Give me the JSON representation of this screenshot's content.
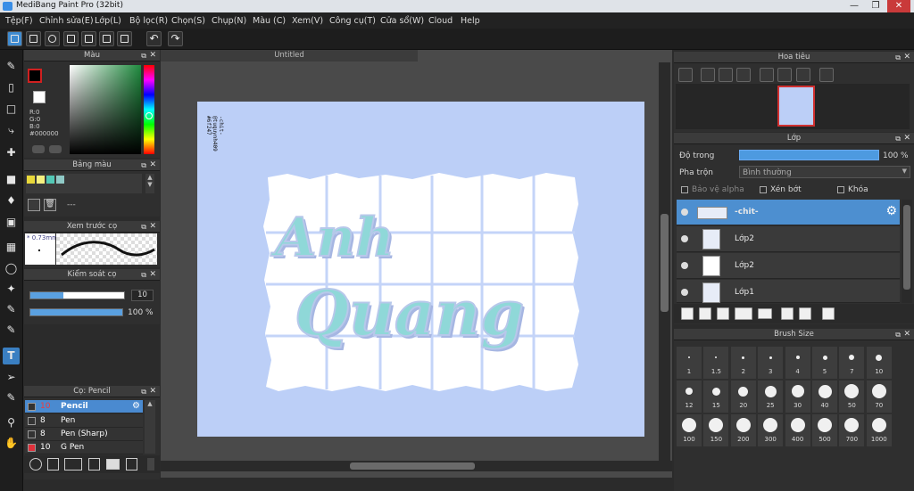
{
  "window": {
    "title": "MediBang Paint Pro (32bit)"
  },
  "menu": [
    "Tệp(F)",
    "Chỉnh sửa(E)",
    "Lớp(L)",
    "Bộ lọc(R)",
    "Chọn(S)",
    "Chụp(N)",
    "Màu (C)",
    "Xem(V)",
    "Công cụ(T)",
    "Cửa sổ(W)",
    "Cloud",
    "Help"
  ],
  "color_panel": {
    "title": "Màu",
    "r": "R:0",
    "g": "G:0",
    "b": "B:0",
    "hex": "#000000",
    "foreground": "#000000"
  },
  "palette_panel": {
    "title": "Bảng màu",
    "swatches": [
      "#e8d83a",
      "#f5f080",
      "#53c8b5",
      "#8fc9c6"
    ],
    "dashes": "---"
  },
  "preview_panel": {
    "title": "Xem trước cọ",
    "size": "0.73mm"
  },
  "control_panel": {
    "title": "Kiểm soát cọ",
    "size_value": "10",
    "opacity_value": "100 %",
    "size_level": 0.35,
    "opacity_level": 1.0
  },
  "brush_panel": {
    "title": "Cọ: Pencil",
    "items": [
      {
        "size": "10",
        "name": "Pencil",
        "color": "#333333",
        "selected": true
      },
      {
        "size": "8",
        "name": "Pen",
        "color": "#333333",
        "selected": false
      },
      {
        "size": "8",
        "name": "Pen (Sharp)",
        "color": "#333333",
        "selected": false
      },
      {
        "size": "10",
        "name": "G Pen",
        "color": "#e0303a",
        "selected": false
      }
    ]
  },
  "canvas": {
    "tab": "Untitled",
    "signature": "-chit-\n@tuquynh409\n#6f247",
    "lettering_line1": "Anh",
    "lettering_line2": "Quang",
    "background": "#bccff7"
  },
  "navigator": {
    "title": "Hoa tiêu"
  },
  "layer_panel": {
    "title": "Lớp",
    "opacity_label": "Độ trong",
    "opacity_value": "100 %",
    "blend_label": "Pha trộn",
    "blend_value": "Bình thường",
    "protect_alpha": "Bảo vệ alpha",
    "clip": "Xén bớt",
    "lock": "Khóa",
    "layers": [
      {
        "name": "-chit-",
        "selected": true
      },
      {
        "name": "Lớp2",
        "selected": false
      },
      {
        "name": "Lớp2",
        "selected": false
      },
      {
        "name": "Lớp1",
        "selected": false
      }
    ]
  },
  "brush_size_panel": {
    "title": "Brush Size",
    "sizes": [
      "1",
      "1.5",
      "2",
      "3",
      "4",
      "5",
      "7",
      "10",
      "12",
      "15",
      "20",
      "25",
      "30",
      "40",
      "50",
      "70",
      "100",
      "150",
      "200",
      "300",
      "400",
      "500",
      "700",
      "1000"
    ]
  }
}
